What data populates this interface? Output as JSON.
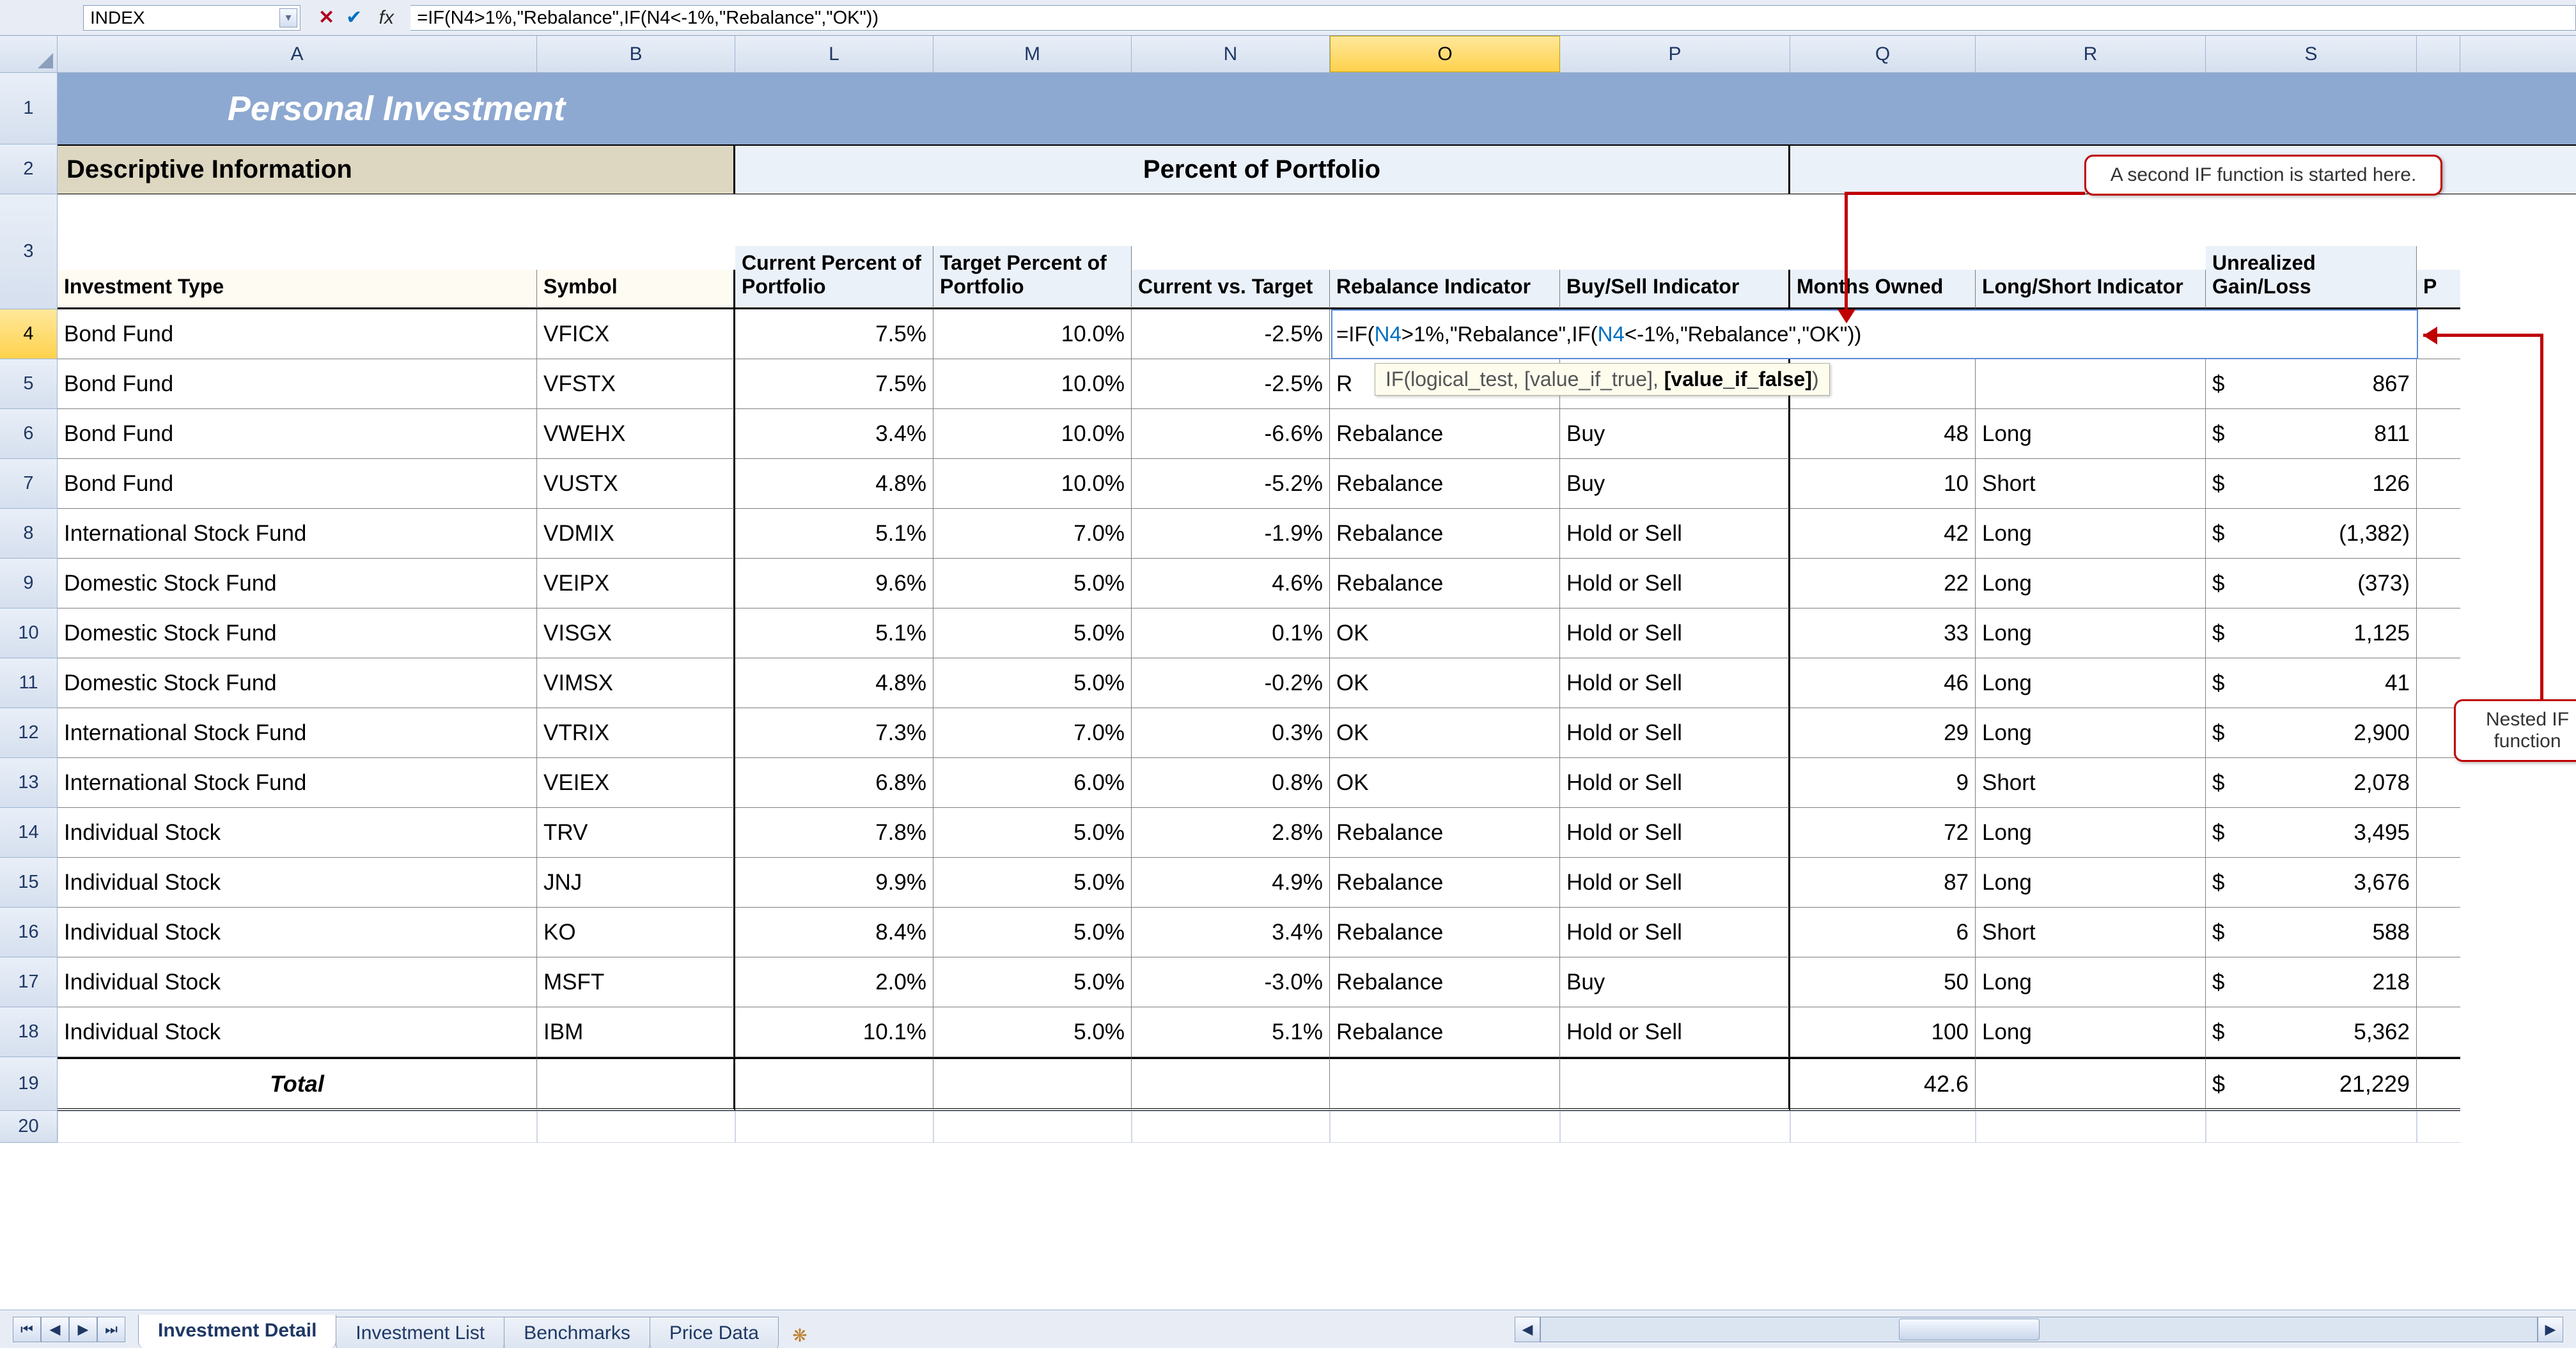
{
  "namebox": "INDEX",
  "formula": "=IF(N4>1%,\"Rebalance\",IF(N4<-1%,\"Rebalance\",\"OK\"))",
  "syntax_tip_prefix": "IF(logical_test, [value_if_true], ",
  "syntax_tip_bold": "[value_if_false]",
  "syntax_tip_suffix": ")",
  "columns": [
    "A",
    "B",
    "L",
    "M",
    "N",
    "O",
    "P",
    "Q",
    "R",
    "S"
  ],
  "active_col": "O",
  "active_row": "4",
  "title": "Personal Investment",
  "section_desc": "Descriptive Information",
  "section_port": "Percent of Portfolio",
  "col_headers": {
    "A": "Investment Type",
    "B": "Symbol",
    "L": "Current Percent of Portfolio",
    "M": "Target Percent of Portfolio",
    "N": "Current vs. Target",
    "O": "Rebalance Indicator",
    "P": "Buy/Sell Indicator",
    "Q": "Months Owned",
    "R": "Long/Short Indicator",
    "S": "Unrealized Gain/Loss",
    "T": "P"
  },
  "rows": [
    {
      "n": "4",
      "type": "Bond Fund",
      "sym": "VFICX",
      "cur": "7.5%",
      "tgt": "10.0%",
      "cvt": "-2.5%",
      "reb": "",
      "bs": "",
      "mo": "",
      "ls": "",
      "gl": ""
    },
    {
      "n": "5",
      "type": "Bond Fund",
      "sym": "VFSTX",
      "cur": "7.5%",
      "tgt": "10.0%",
      "cvt": "-2.5%",
      "reb": "R",
      "bs": "",
      "mo": "",
      "ls": "",
      "gl": "867"
    },
    {
      "n": "6",
      "type": "Bond Fund",
      "sym": "VWEHX",
      "cur": "3.4%",
      "tgt": "10.0%",
      "cvt": "-6.6%",
      "reb": "Rebalance",
      "bs": "Buy",
      "mo": "48",
      "ls": "Long",
      "gl": "811"
    },
    {
      "n": "7",
      "type": "Bond Fund",
      "sym": "VUSTX",
      "cur": "4.8%",
      "tgt": "10.0%",
      "cvt": "-5.2%",
      "reb": "Rebalance",
      "bs": "Buy",
      "mo": "10",
      "ls": "Short",
      "gl": "126"
    },
    {
      "n": "8",
      "type": "International Stock Fund",
      "sym": "VDMIX",
      "cur": "5.1%",
      "tgt": "7.0%",
      "cvt": "-1.9%",
      "reb": "Rebalance",
      "bs": "Hold or Sell",
      "mo": "42",
      "ls": "Long",
      "gl": "(1,382)"
    },
    {
      "n": "9",
      "type": "Domestic Stock Fund",
      "sym": "VEIPX",
      "cur": "9.6%",
      "tgt": "5.0%",
      "cvt": "4.6%",
      "reb": "Rebalance",
      "bs": "Hold or Sell",
      "mo": "22",
      "ls": "Long",
      "gl": "(373)"
    },
    {
      "n": "10",
      "type": "Domestic Stock Fund",
      "sym": "VISGX",
      "cur": "5.1%",
      "tgt": "5.0%",
      "cvt": "0.1%",
      "reb": "OK",
      "bs": "Hold or Sell",
      "mo": "33",
      "ls": "Long",
      "gl": "1,125"
    },
    {
      "n": "11",
      "type": "Domestic Stock Fund",
      "sym": "VIMSX",
      "cur": "4.8%",
      "tgt": "5.0%",
      "cvt": "-0.2%",
      "reb": "OK",
      "bs": "Hold or Sell",
      "mo": "46",
      "ls": "Long",
      "gl": "41"
    },
    {
      "n": "12",
      "type": "International Stock Fund",
      "sym": "VTRIX",
      "cur": "7.3%",
      "tgt": "7.0%",
      "cvt": "0.3%",
      "reb": "OK",
      "bs": "Hold or Sell",
      "mo": "29",
      "ls": "Long",
      "gl": "2,900"
    },
    {
      "n": "13",
      "type": "International Stock Fund",
      "sym": "VEIEX",
      "cur": "6.8%",
      "tgt": "6.0%",
      "cvt": "0.8%",
      "reb": "OK",
      "bs": "Hold or Sell",
      "mo": "9",
      "ls": "Short",
      "gl": "2,078"
    },
    {
      "n": "14",
      "type": "Individual Stock",
      "sym": "TRV",
      "cur": "7.8%",
      "tgt": "5.0%",
      "cvt": "2.8%",
      "reb": "Rebalance",
      "bs": "Hold or Sell",
      "mo": "72",
      "ls": "Long",
      "gl": "3,495"
    },
    {
      "n": "15",
      "type": "Individual Stock",
      "sym": "JNJ",
      "cur": "9.9%",
      "tgt": "5.0%",
      "cvt": "4.9%",
      "reb": "Rebalance",
      "bs": "Hold or Sell",
      "mo": "87",
      "ls": "Long",
      "gl": "3,676"
    },
    {
      "n": "16",
      "type": "Individual Stock",
      "sym": "KO",
      "cur": "8.4%",
      "tgt": "5.0%",
      "cvt": "3.4%",
      "reb": "Rebalance",
      "bs": "Hold or Sell",
      "mo": "6",
      "ls": "Short",
      "gl": "588"
    },
    {
      "n": "17",
      "type": "Individual Stock",
      "sym": "MSFT",
      "cur": "2.0%",
      "tgt": "5.0%",
      "cvt": "-3.0%",
      "reb": "Rebalance",
      "bs": "Buy",
      "mo": "50",
      "ls": "Long",
      "gl": "218"
    },
    {
      "n": "18",
      "type": "Individual Stock",
      "sym": "IBM",
      "cur": "10.1%",
      "tgt": "5.0%",
      "cvt": "5.1%",
      "reb": "Rebalance",
      "bs": "Hold or Sell",
      "mo": "100",
      "ls": "Long",
      "gl": "5,362"
    }
  ],
  "total": {
    "label": "Total",
    "mo": "42.6",
    "gl": "21,229"
  },
  "row20": "20",
  "currency": "$",
  "tabs": {
    "active": "Investment Detail",
    "others": [
      "Investment List",
      "Benchmarks",
      "Price Data"
    ]
  },
  "callout1": "A second IF function is started here.",
  "callout2": "Nested IF function",
  "edit_tokens": [
    "=",
    "IF",
    "(",
    "N4",
    ">1%,\"Rebalance\",",
    "IF",
    "(",
    "N4",
    "<-1%,\"Rebalance\",\"OK\"))"
  ]
}
